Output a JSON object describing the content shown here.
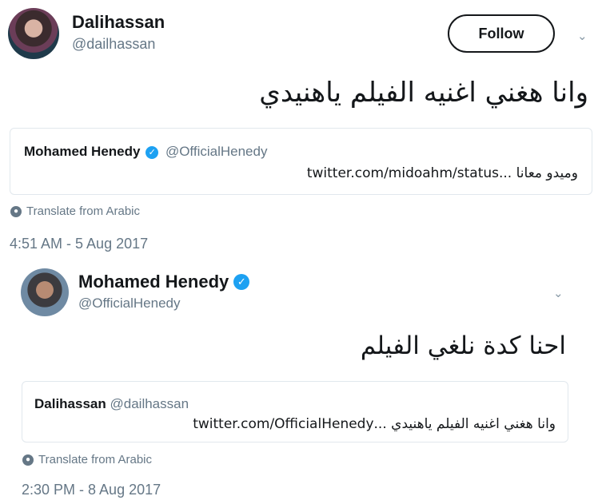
{
  "tweet1": {
    "author_name": "Dalihassan",
    "author_handle": "@dailhassan",
    "follow_label": "Follow",
    "text": "وانا هغني اغنيه الفيلم ياهنيدي",
    "quote": {
      "author_name": "Mohamed Henedy",
      "author_handle": "@OfficialHenedy",
      "text": "وميدو معانا ...twitter.com/midoahm/status"
    },
    "translate_label": "Translate from Arabic",
    "timestamp": "4:51 AM - 5 Aug 2017"
  },
  "tweet2": {
    "author_name": "Mohamed Henedy",
    "author_handle": "@OfficialHenedy",
    "text": "احنا كدة نلغي الفيلم",
    "quote": {
      "author_name": "Dalihassan",
      "author_handle": "@dailhassan",
      "text": "وانا هغني اغنيه الفيلم ياهنيدي ...twitter.com/OfficialHenedy"
    },
    "translate_label": "Translate from Arabic",
    "timestamp": "2:30 PM - 8 Aug 2017"
  },
  "icons": {
    "verified": "verified-badge-icon",
    "globe": "globe-icon",
    "chevron": "chevron-down-icon"
  },
  "colors": {
    "verified_blue": "#1da1f2",
    "secondary_text": "#657786",
    "border": "#e1e8ed"
  }
}
